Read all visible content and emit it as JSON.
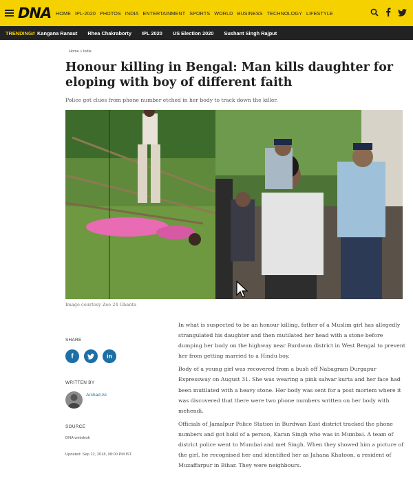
{
  "header": {
    "logo": "DNA",
    "nav": [
      "HOME",
      "IPL-2020",
      "PHOTOS",
      "INDIA",
      "ENTERTAINMENT",
      "SPORTS",
      "WORLD",
      "BUSINESS",
      "TECHNOLOGY",
      "LIFESTYLE"
    ],
    "icons": [
      "search-icon",
      "facebook-icon",
      "twitter-icon"
    ],
    "colors": {
      "bar": "#f6d100",
      "trend_bg": "#222222",
      "accent": "#1d6fa5"
    }
  },
  "trending": {
    "label": "TRENDING#",
    "items": [
      "Kangana Ranaut",
      "Rhea Chakraborty",
      "IPL 2020",
      "US Election 2020",
      "Sushant Singh Rajput"
    ]
  },
  "breadcrumb": {
    "home": "Home",
    "sep": "»",
    "section": "India"
  },
  "article": {
    "title": "Honour killing in Bengal: Man kills daughter for eloping with boy of different faith",
    "subtitle": "Police got clues from phone number etched in her body to track down the killer.",
    "image_caption": "Image courtesy Zee 24 Ghanta",
    "paragraphs": [
      "In what is suspected to be an honour killing, father of a Muslim girl has allegedly strangulated his daughter and then mutilated her head with a stone before dumping her body on the highway near Burdwan district in West Bengal to prevent her from getting married to a Hindu boy.",
      "Body of a young girl was recovered from a bush off Nabagram Durgapur Expressway on August 31. She was wearing a pink salwar kurta and her face had been mutilated with a heavy stone. Her body was sent for a post mortem where it was discovered that there were two phone numbers written on her body with mehendi.",
      "Officials of Jamalpur Police Station in Burdwan East district tracked the phone numbers and got hold of a person, Karan Singh who was in Mumbai. A team of district police went to Mumbai and met Singh. When they showed him a picture of the girl, he recognised her and identified her as Jahana Khatoon, a resident of Muzaffarpur in Bihar. They were neighbours."
    ]
  },
  "sidebar": {
    "share_label": "SHARE",
    "share_icons": [
      "facebook-icon",
      "twitter-icon",
      "linkedin-icon"
    ],
    "written_by_label": "WRITTEN BY",
    "author": "Arshad Ali",
    "source_label": "SOURCE",
    "source": "DNA webdesk",
    "updated": "Updated: Sep 12, 2018, 08:00 PM IST"
  }
}
